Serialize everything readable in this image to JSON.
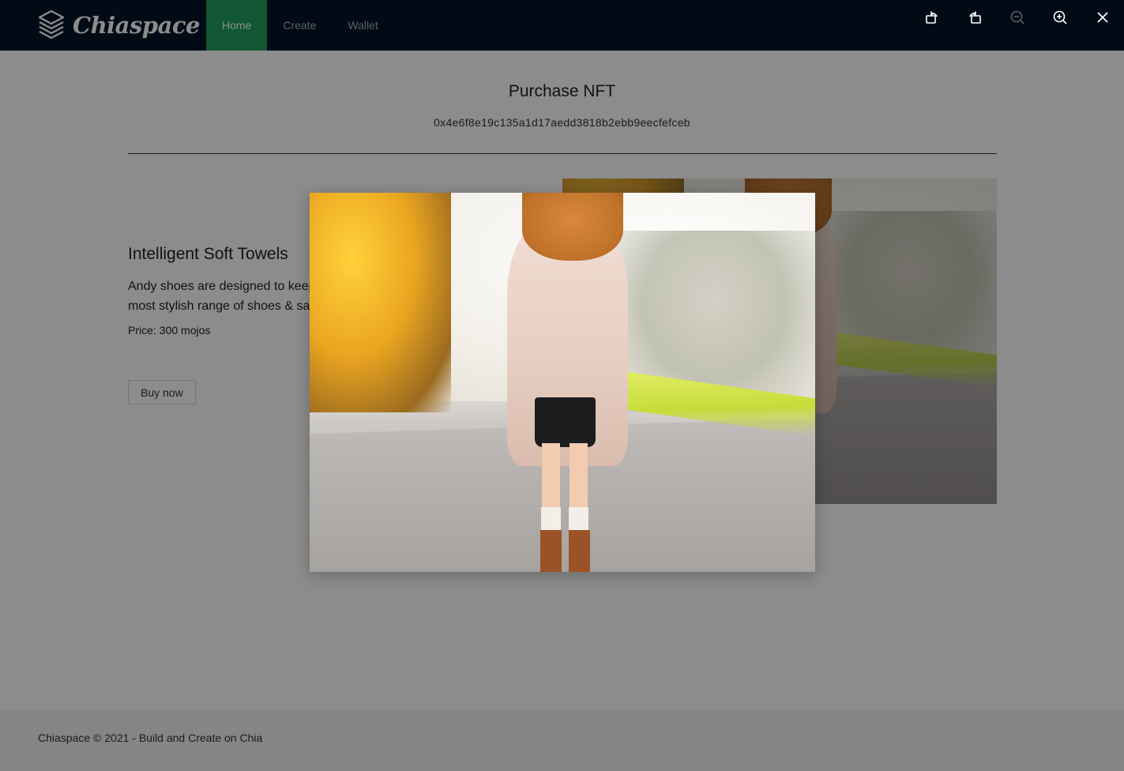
{
  "header": {
    "logo_text": "Chiaspace",
    "nav": [
      {
        "label": "Home",
        "active": true
      },
      {
        "label": "Create",
        "active": false
      },
      {
        "label": "Wallet",
        "active": false
      }
    ]
  },
  "page": {
    "title": "Purchase NFT",
    "address": "0x4e6f8e19c135a1d17aedd3818b2ebb9eecfefceb"
  },
  "product": {
    "name": "Intelligent Soft Towels",
    "description": "Andy shoes are designed to keeping in mind durability as well as trends, the most stylish range of shoes & sandals",
    "price_label": "Price:",
    "price_value": "300 mojos",
    "buy_label": "Buy now"
  },
  "footer": {
    "text": "Chiaspace © 2021 - Build and Create on Chia"
  },
  "preview": {
    "toolbar": [
      {
        "icon": "rotate-left-icon",
        "disabled": false
      },
      {
        "icon": "rotate-right-icon",
        "disabled": false
      },
      {
        "icon": "zoom-out-icon",
        "disabled": true
      },
      {
        "icon": "zoom-in-icon",
        "disabled": false
      },
      {
        "icon": "close-icon",
        "disabled": false
      }
    ]
  },
  "colors": {
    "header_bg": "#001529",
    "nav_active_bg": "#1f9e5e",
    "page_bg": "#ffffff",
    "footer_bg": "#f0f2f5"
  }
}
